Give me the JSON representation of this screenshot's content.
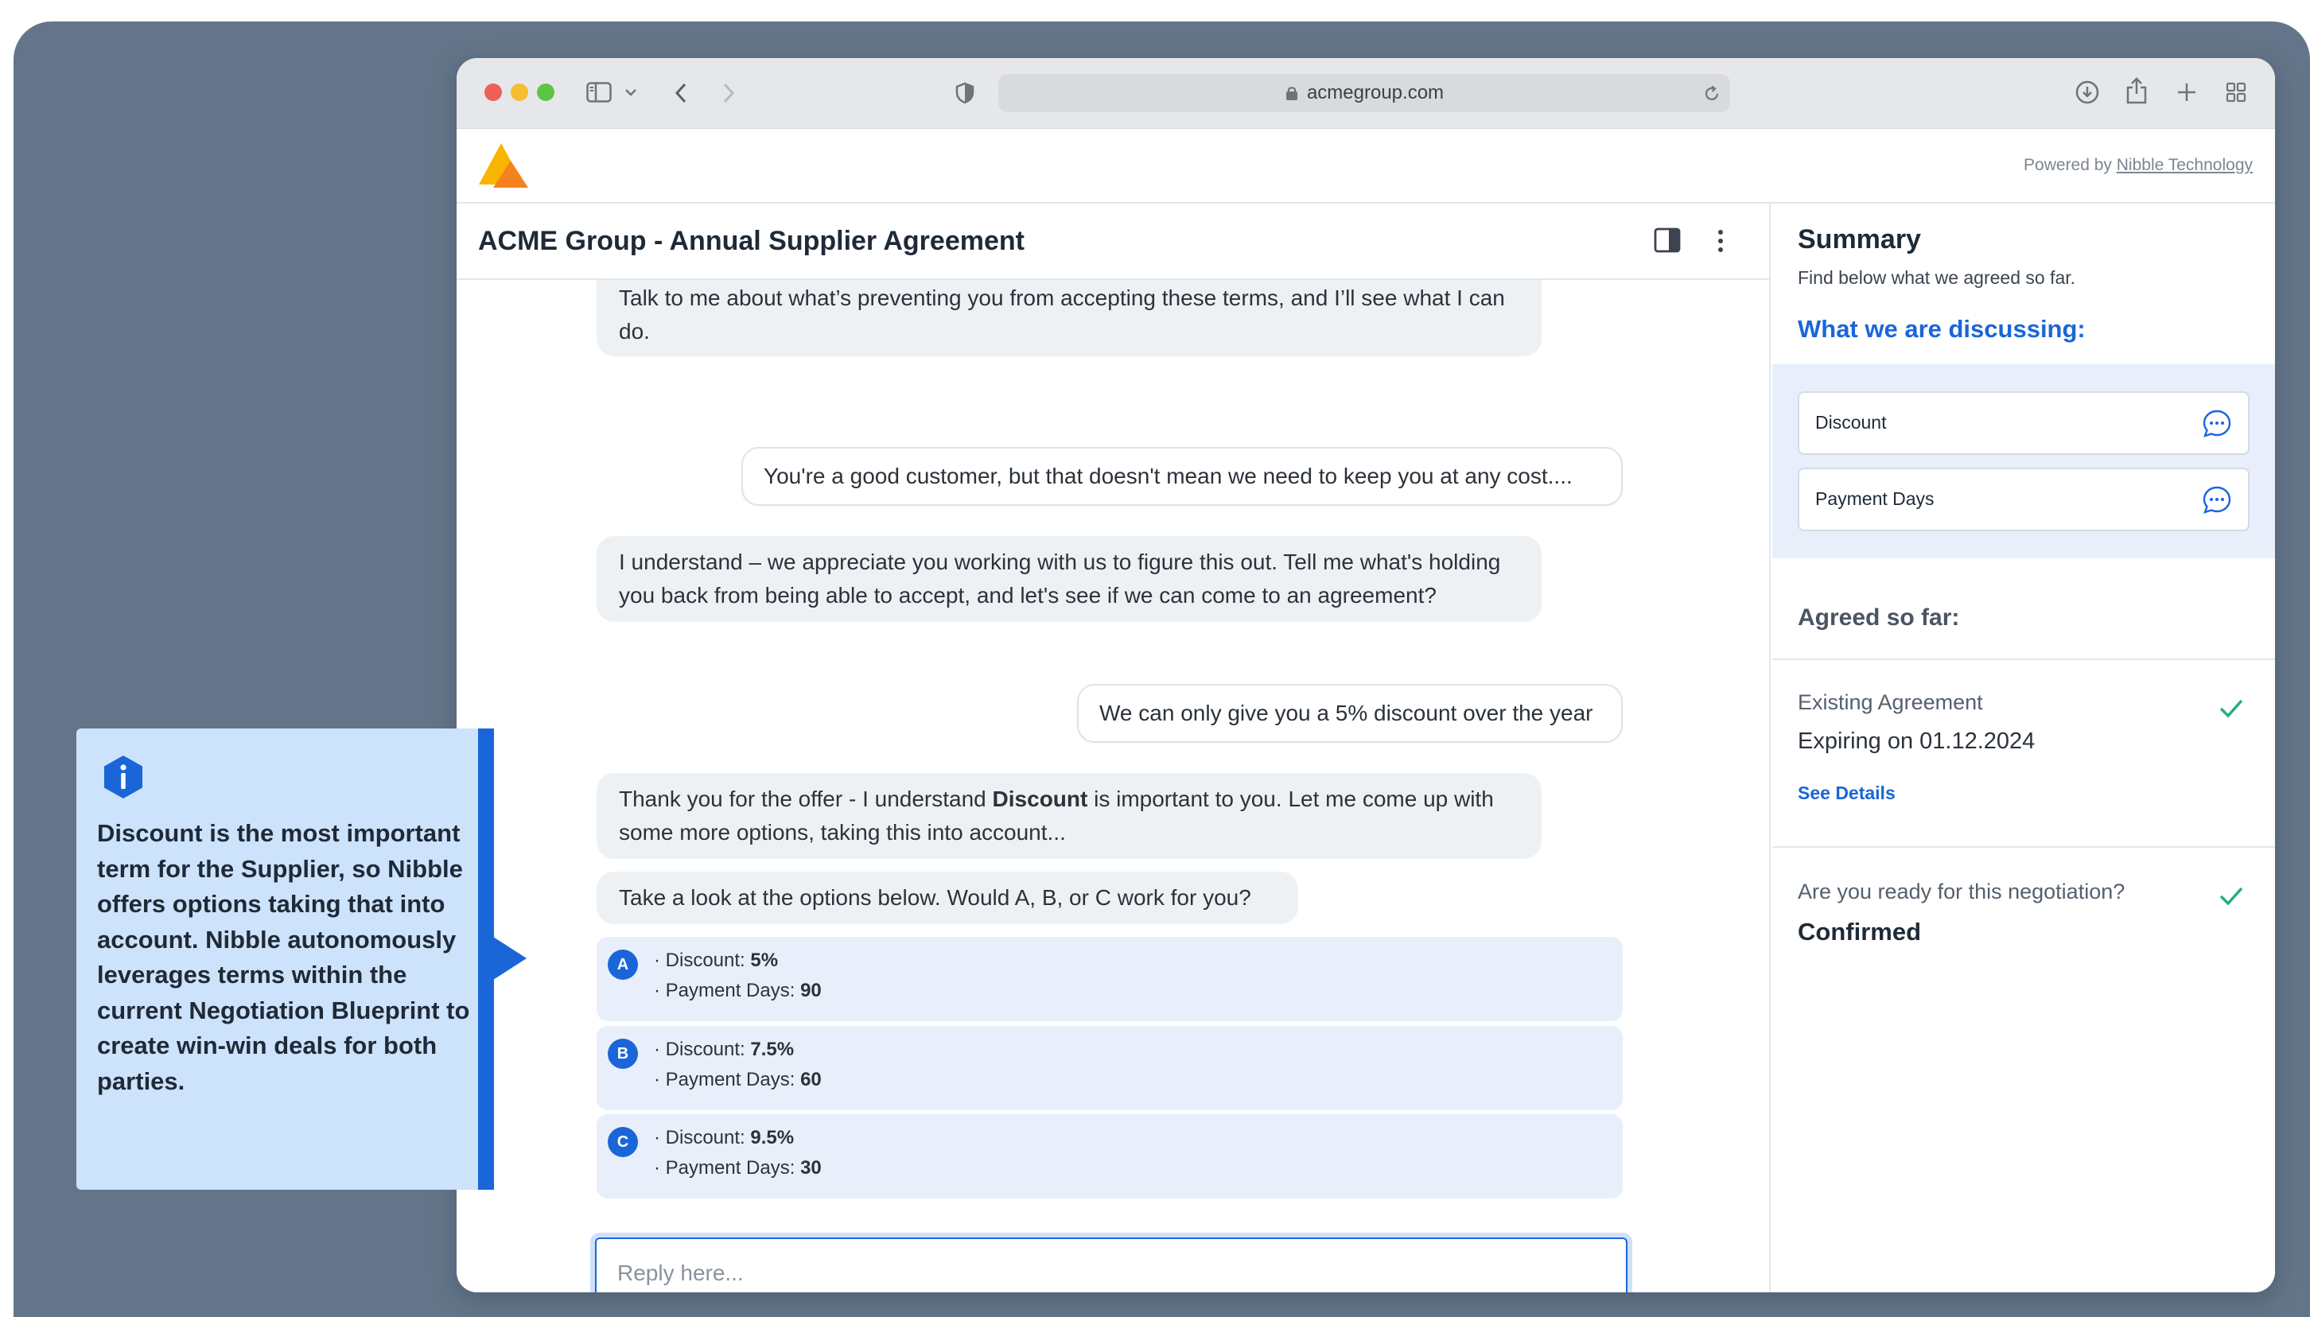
{
  "browser": {
    "url": "acmegroup.com"
  },
  "app": {
    "powered_prefix": "Powered by",
    "powered_link": "Nibble Technology"
  },
  "chat": {
    "title": "ACME Group - Annual Supplier Agreement",
    "messages": [
      {
        "from": "bot",
        "text": "Talk to me about what’s preventing you from accepting these terms, and I’ll see what I can do."
      },
      {
        "from": "user",
        "text": "You're a good customer, but that doesn't mean we need to keep you at any cost...."
      },
      {
        "from": "bot",
        "text": "I understand – we appreciate you working with us to figure this out. Tell me what's holding you back from being able to accept, and let's see if we can come to an agreement?"
      },
      {
        "from": "user",
        "text": "We can only give you a 5% discount over the year"
      },
      {
        "from": "bot",
        "text_before": "Thank you for the offer - I understand ",
        "text_bold": "Discount",
        "text_after": " is important to you. Let me come up with some more options, taking this into account..."
      },
      {
        "from": "bot",
        "text": "Take a look at the options below. Would A, B, or C work for you?"
      }
    ],
    "options": [
      {
        "letter": "A",
        "discount_label": "· Discount: ",
        "discount": "5%",
        "days_label": "· Payment Days: ",
        "days": "90"
      },
      {
        "letter": "B",
        "discount_label": "· Discount: ",
        "discount": "7.5%",
        "days_label": "· Payment Days: ",
        "days": "60"
      },
      {
        "letter": "C",
        "discount_label": "· Discount: ",
        "discount": "9.5%",
        "days_label": "· Payment Days: ",
        "days": "30"
      }
    ],
    "reply_placeholder": "Reply here..."
  },
  "summary": {
    "title": "Summary",
    "subtitle": "Find below what we agreed so far.",
    "discussing_title": "What we are discussing:",
    "discussing_items": [
      "Discount",
      "Payment Days"
    ],
    "agreed_title": "Agreed so far:",
    "existing_label": "Existing Agreement",
    "existing_value": "Expiring on 01.12.2024",
    "see_details": "See Details",
    "ready_label": "Are you ready for this negotiation?",
    "ready_value": "Confirmed"
  },
  "callout": {
    "text": "Discount is the most important term for the Supplier, so Nibble offers options taking that into account. Nibble autonomously leverages terms within the current Negotiation Blueprint to create win-win deals for both parties."
  },
  "colors": {
    "accent": "#1a66d9",
    "background": "#647589",
    "check": "#22b07d",
    "logo_yellow": "#f7b500",
    "logo_orange": "#f5821f"
  },
  "icons": [
    "sidebar-icon",
    "chevron-down-icon",
    "back-icon",
    "forward-icon",
    "shield-icon",
    "lock-icon",
    "reload-icon",
    "download-icon",
    "share-icon",
    "new-tab-icon",
    "tabs-overview-icon",
    "split-view-icon",
    "more-vertical-icon",
    "chat-bubble-icon",
    "check-icon",
    "info-icon"
  ]
}
